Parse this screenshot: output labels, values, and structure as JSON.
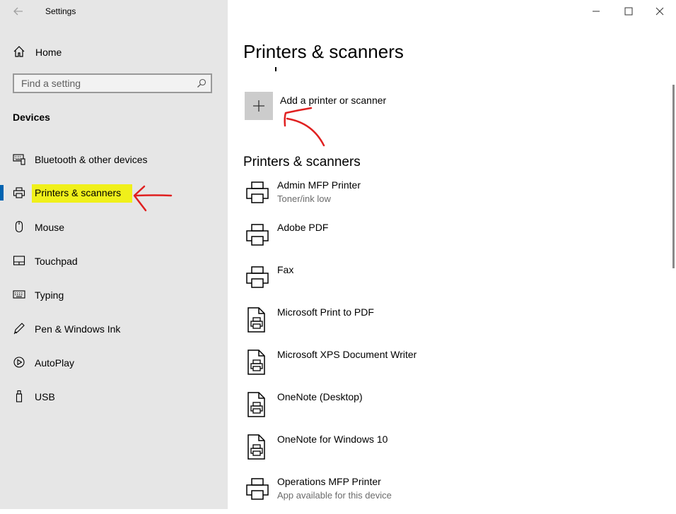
{
  "window": {
    "title": "Settings",
    "back_icon": "back-arrow-icon",
    "controls": [
      "minimize-icon",
      "maximize-icon",
      "close-icon"
    ]
  },
  "sidebar": {
    "home_label": "Home",
    "search_placeholder": "Find a setting",
    "section_title": "Devices",
    "items": [
      {
        "label": "Bluetooth & other devices",
        "icon": "bluetooth-keyboard-icon"
      },
      {
        "label": "Printers & scanners",
        "icon": "printer-icon",
        "active": true
      },
      {
        "label": "Mouse",
        "icon": "mouse-icon"
      },
      {
        "label": "Touchpad",
        "icon": "touchpad-icon"
      },
      {
        "label": "Typing",
        "icon": "keyboard-icon"
      },
      {
        "label": "Pen & Windows Ink",
        "icon": "pen-icon"
      },
      {
        "label": "AutoPlay",
        "icon": "autoplay-icon"
      },
      {
        "label": "USB",
        "icon": "usb-icon"
      }
    ]
  },
  "main": {
    "page_title": "Printers & scanners",
    "add_label": "Add a printer or scanner",
    "list_title": "Printers & scanners",
    "printers": [
      {
        "name": "Admin MFP Printer",
        "status": "Toner/ink low",
        "icon": "printer-icon"
      },
      {
        "name": "Adobe PDF",
        "status": "",
        "icon": "printer-icon"
      },
      {
        "name": "Fax",
        "status": "",
        "icon": "printer-icon"
      },
      {
        "name": "Microsoft Print to PDF",
        "status": "",
        "icon": "document-printer-icon"
      },
      {
        "name": "Microsoft XPS Document Writer",
        "status": "",
        "icon": "document-printer-icon"
      },
      {
        "name": "OneNote (Desktop)",
        "status": "",
        "icon": "document-printer-icon"
      },
      {
        "name": "OneNote for Windows 10",
        "status": "",
        "icon": "document-printer-icon"
      },
      {
        "name": "Operations MFP Printer",
        "status": "App available for this device",
        "icon": "printer-icon"
      }
    ]
  },
  "colors": {
    "sidebar_bg": "#e6e6e6",
    "accent": "#0063b1",
    "highlight": "#f0f01a",
    "annotation_arrow": "#e02020"
  }
}
